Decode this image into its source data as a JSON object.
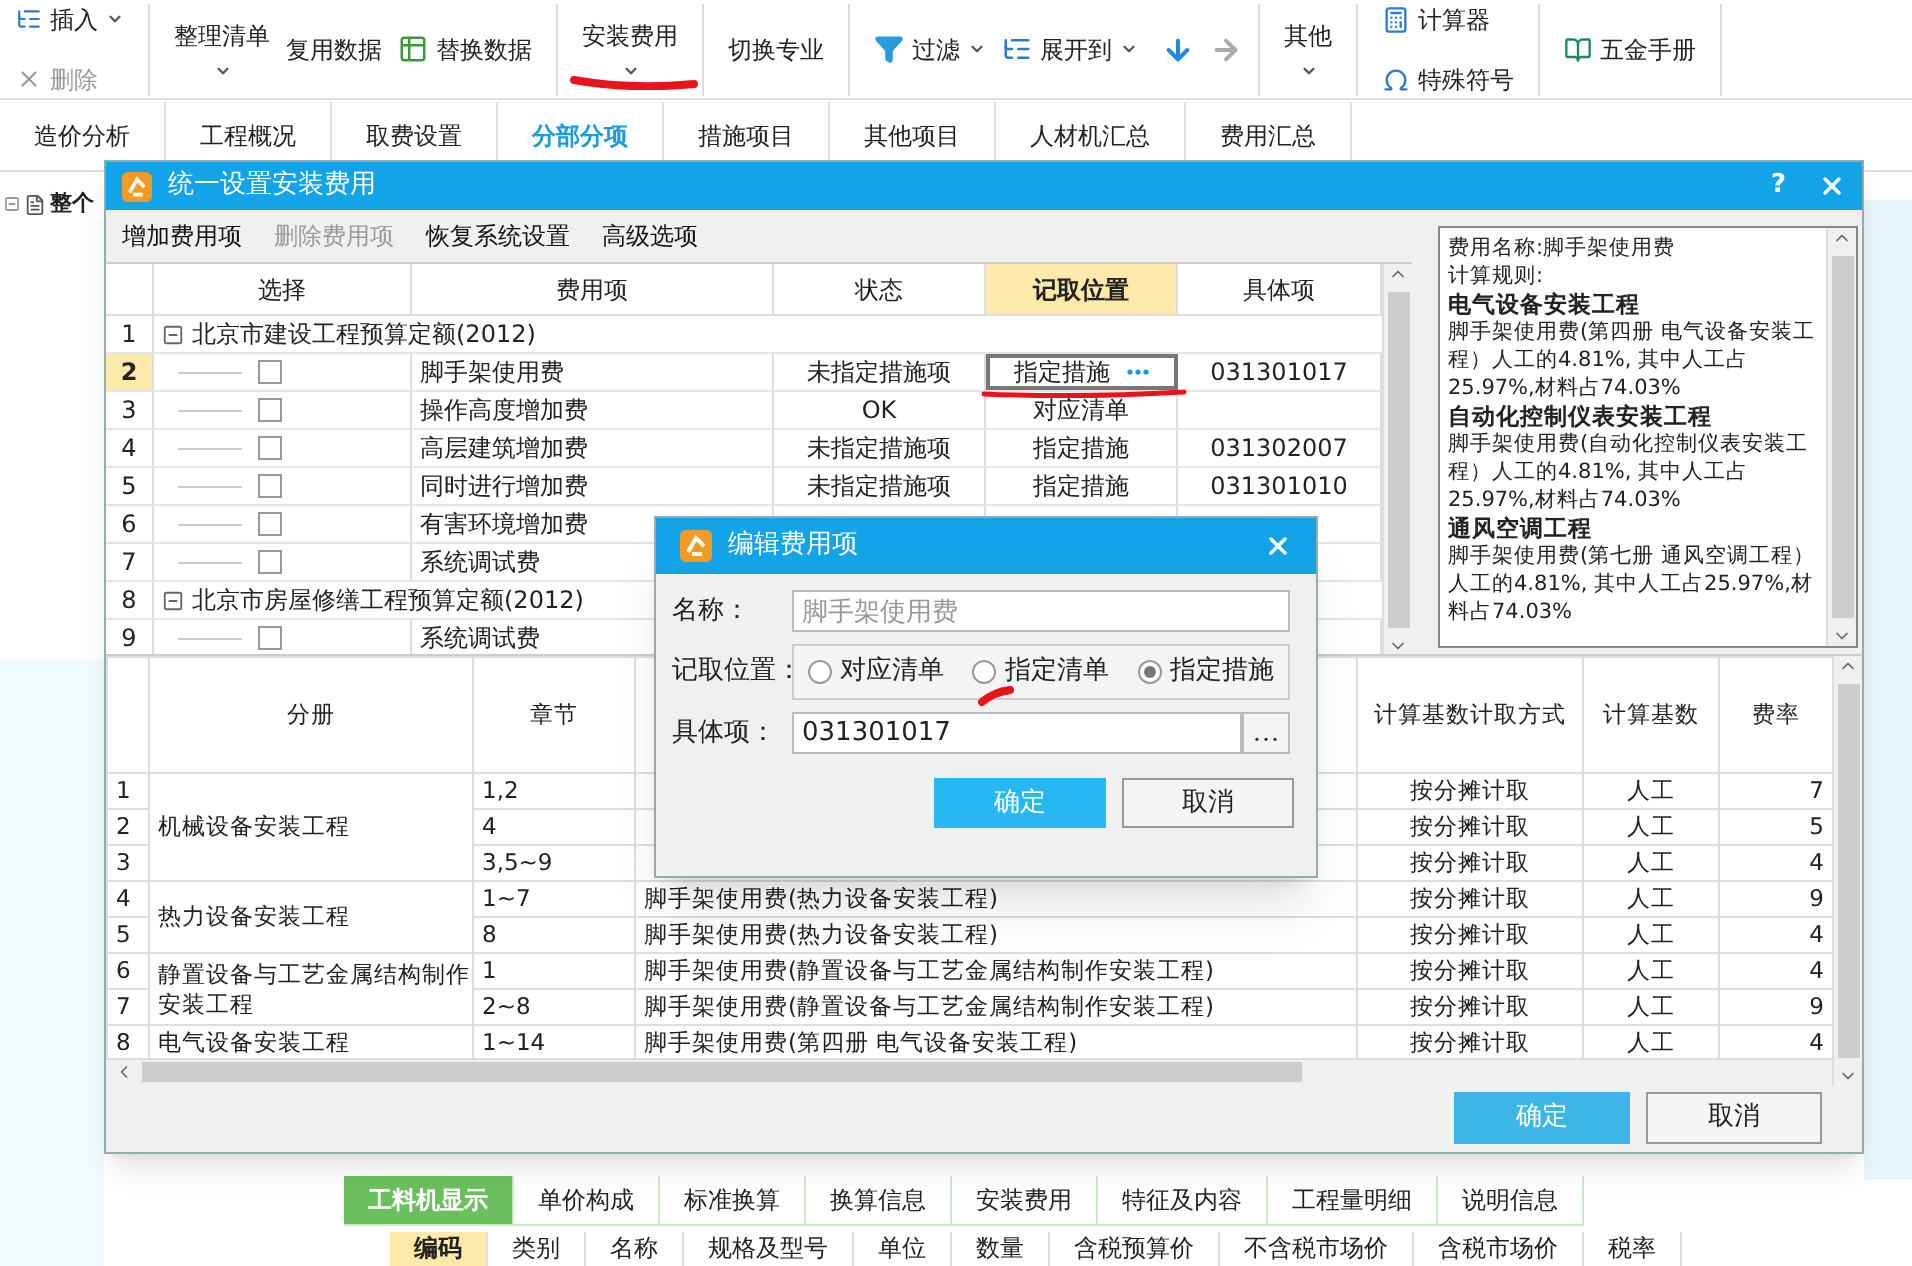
{
  "toolbar": {
    "items": [
      {
        "label": "插入",
        "disabled": false
      },
      {
        "label": "删除",
        "disabled": true
      },
      {
        "label": "整理清单"
      },
      {
        "label": "复用数据"
      },
      {
        "label": "替换数据"
      },
      {
        "label": "安装费用"
      },
      {
        "label": "切换专业"
      },
      {
        "label": "过滤"
      },
      {
        "label": "展开到"
      },
      {
        "label": "其他"
      },
      {
        "label": "计算器"
      },
      {
        "label": "特殊符号"
      },
      {
        "label": "五金手册"
      }
    ]
  },
  "tabs": [
    {
      "label": "造价分析",
      "selected": false
    },
    {
      "label": "工程概况",
      "selected": false
    },
    {
      "label": "取费设置",
      "selected": false
    },
    {
      "label": "分部分项",
      "selected": true
    },
    {
      "label": "措施项目",
      "selected": false
    },
    {
      "label": "其他项目",
      "selected": false
    },
    {
      "label": "人材机汇总",
      "selected": false
    },
    {
      "label": "费用汇总",
      "selected": false
    }
  ],
  "tree": {
    "items": [
      {
        "label": "整个"
      }
    ]
  },
  "dialog": {
    "title": "统一设置安装费用",
    "help": "?",
    "menu": [
      {
        "label": "增加费用项",
        "disabled": false
      },
      {
        "label": "删除费用项",
        "disabled": true
      },
      {
        "label": "恢复系统设置",
        "disabled": false
      },
      {
        "label": "高级选项",
        "disabled": false
      }
    ],
    "table": {
      "columns": [
        {
          "label": "选择",
          "selected": false
        },
        {
          "label": "费用项",
          "selected": false
        },
        {
          "label": "状态",
          "selected": false
        },
        {
          "label": "记取位置",
          "selected": true
        },
        {
          "label": "具体项",
          "selected": false
        }
      ],
      "rows": [
        {
          "no": "1",
          "name": "北京市建设工程预算定额(2012)",
          "expanded": true,
          "children": [
            {
              "no": "2",
              "name": "脚手架使用费",
              "checked": false,
              "status": "未指定措施项",
              "position": "指定措施",
              "code": "031301017",
              "selected": true
            },
            {
              "no": "3",
              "name": "操作高度增加费",
              "checked": false,
              "status": "OK",
              "position": "对应清单",
              "selected": false
            },
            {
              "no": "4",
              "name": "高层建筑增加费",
              "checked": false,
              "status": "未指定措施项",
              "position": "指定措施",
              "code": "031302007",
              "selected": false
            },
            {
              "no": "5",
              "name": "同时进行增加费",
              "checked": false,
              "status": "未指定措施项",
              "position": "指定措施",
              "code": "031301010",
              "selected": false
            },
            {
              "no": "6",
              "name": "有害环境增加费",
              "checked": false,
              "selected": false
            },
            {
              "no": "7",
              "name": "系统调试费",
              "checked": false,
              "selected": false
            }
          ]
        },
        {
          "no": "8",
          "name": "北京市房屋修缮工程预算定额(2012)",
          "expanded": true,
          "children": [
            {
              "no": "9",
              "name": "系统调试费",
              "checked": false,
              "selected": false
            }
          ]
        }
      ]
    },
    "info": {
      "lines": [
        {
          "kind": "text",
          "text": "费用名称:脚手架使用费"
        },
        {
          "kind": "text",
          "text": "计算规则:"
        },
        {
          "kind": "heading",
          "text": "电气设备安装工程"
        },
        {
          "kind": "text",
          "text": "脚手架使用费(第四册 电气设备安装工程）人工的4.81%, 其中人工占25.97%,材料占74.03%"
        },
        {
          "kind": "heading",
          "text": "自动化控制仪表安装工程"
        },
        {
          "kind": "text",
          "text": "脚手架使用费(自动化控制仪表安装工程）人工的4.81%, 其中人工占25.97%,材料占74.03%"
        },
        {
          "kind": "heading",
          "text": "通风空调工程"
        },
        {
          "kind": "text",
          "text": "脚手架使用费(第七册 通风空调工程）人工的4.81%, 其中人工占25.97%,材料占74.03%"
        }
      ]
    },
    "rules": {
      "columns": [
        "分册",
        "章节",
        "计算基数计取方式",
        "计算基数",
        "费率"
      ],
      "groups": [
        {
          "volume": "机械设备安装工程",
          "rows": [
            {
              "no": "1",
              "chapter": "1,2",
              "method": "按分摊计取",
              "base": "人工",
              "rate": "7"
            },
            {
              "no": "2",
              "chapter": "4",
              "method": "按分摊计取",
              "base": "人工",
              "rate": "5"
            },
            {
              "no": "3",
              "chapter": "3,5~9",
              "method": "按分摊计取",
              "base": "人工",
              "rate": "4"
            }
          ]
        },
        {
          "volume": "热力设备安装工程",
          "rows": [
            {
              "no": "4",
              "chapter": "1~7",
              "item": "脚手架使用费(热力设备安装工程)",
              "method": "按分摊计取",
              "base": "人工",
              "rate": "9"
            },
            {
              "no": "5",
              "chapter": "8",
              "item": "脚手架使用费(热力设备安装工程)",
              "method": "按分摊计取",
              "base": "人工",
              "rate": "4"
            }
          ]
        },
        {
          "volume": "静置设备与工艺金属结构制作安装工程",
          "rows": [
            {
              "no": "6",
              "chapter": "1",
              "item": "脚手架使用费(静置设备与工艺金属结构制作安装工程)",
              "method": "按分摊计取",
              "base": "人工",
              "rate": "4"
            },
            {
              "no": "7",
              "chapter": "2~8",
              "item": "脚手架使用费(静置设备与工艺金属结构制作安装工程)",
              "method": "按分摊计取",
              "base": "人工",
              "rate": "9"
            }
          ]
        },
        {
          "volume": "电气设备安装工程",
          "rows": [
            {
              "no": "8",
              "chapter": "1~14",
              "item": "脚手架使用费(第四册 电气设备安装工程)",
              "method": "按分摊计取",
              "base": "人工",
              "rate": "4"
            }
          ]
        }
      ]
    },
    "buttons": [
      "确定",
      "取消"
    ]
  },
  "edit_dialog": {
    "title": "编辑费用项",
    "name_label": "名称：",
    "name": {
      "value": "脚手架使用费",
      "disabled": true
    },
    "position_label": "记取位置：",
    "options": [
      {
        "label": "对应清单",
        "selected": false
      },
      {
        "label": "指定清单",
        "selected": false
      },
      {
        "label": "指定措施",
        "selected": true
      }
    ],
    "code_label": "具体项：",
    "code": "031301017",
    "buttons": [
      "确定",
      "取消"
    ]
  },
  "bottom_tabs": [
    {
      "label": "工料机显示",
      "selected": true
    },
    {
      "label": "单价构成",
      "selected": false
    },
    {
      "label": "标准换算",
      "selected": false
    },
    {
      "label": "换算信息",
      "selected": false
    },
    {
      "label": "安装费用",
      "selected": false
    },
    {
      "label": "特征及内容",
      "selected": false
    },
    {
      "label": "工程量明细",
      "selected": false
    },
    {
      "label": "说明信息",
      "selected": false
    }
  ],
  "bottom_columns": [
    "编码",
    "类别",
    "名称",
    "规格及型号",
    "单位",
    "数量",
    "含税预算价",
    "不含税市场价",
    "含税市场价",
    "税率"
  ]
}
